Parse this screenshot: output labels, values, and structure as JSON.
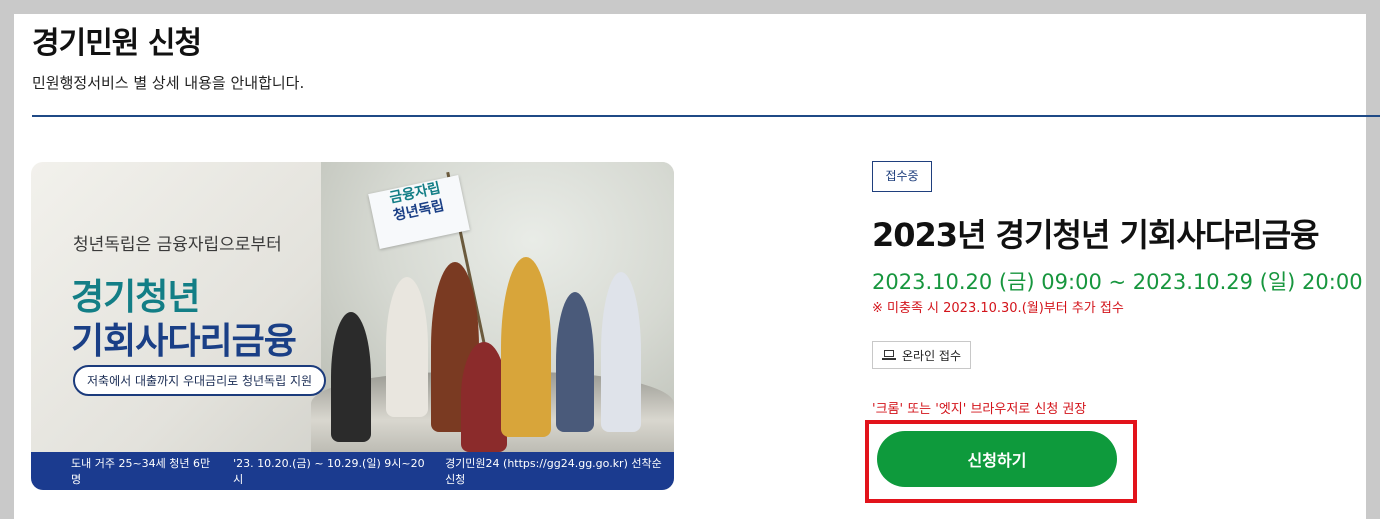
{
  "header": {
    "title": "경기민원 신청",
    "subtitle": "민원행정서비스 별 상세 내용을 안내합니다."
  },
  "banner": {
    "tagline": "청년독립은 금융자립으로부터",
    "title_line1": "경기청년",
    "title_line2": "기회사다리금융",
    "pill": "저축에서 대출까지 우대금리로 청년독립 지원",
    "flag_line1": "금융자립",
    "flag_line2": "청년독립",
    "bottom_items": [
      "도내 거주 25~34세 청년 6만명",
      "'23. 10.20.(금) ~ 10.29.(일) 9시~20시",
      "경기민원24 (https://gg24.gg.go.kr) 선착순 신청"
    ]
  },
  "service": {
    "status_badge": "접수중",
    "title": "2023년 경기청년 기회사다리금융",
    "period": "2023.10.20 (금) 09:00 ~ 2023.10.29 (일) 20:00",
    "notice": "※ 미충족 시 2023.10.30.(월)부터 추가 접수",
    "online_label": "온라인 접수",
    "browser_note": "'크롬' 또는 '엣지' 브라우저로 신청 권장",
    "apply_button": "신청하기"
  },
  "colors": {
    "accent_green": "#0e9a3c",
    "notice_red": "#d3141b",
    "navy": "#1f4a86"
  },
  "icons": {
    "online": "laptop-icon"
  }
}
